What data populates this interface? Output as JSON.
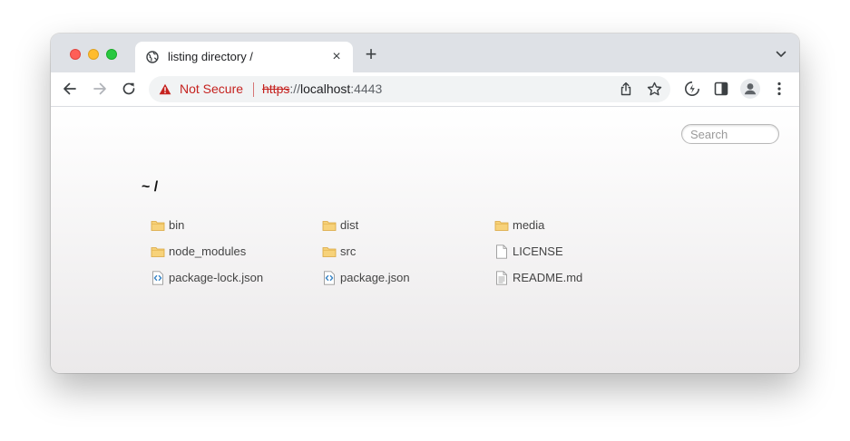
{
  "tab": {
    "title": "listing directory /",
    "close": "×",
    "new_tab": "+"
  },
  "omnibox": {
    "security": "Not Secure",
    "scheme": "https",
    "separator": "://",
    "host": "localhost",
    "port": ":4443"
  },
  "page": {
    "search_placeholder": "Search",
    "heading": "~ /",
    "files": [
      {
        "name": "bin",
        "type": "folder"
      },
      {
        "name": "dist",
        "type": "folder"
      },
      {
        "name": "media",
        "type": "folder"
      },
      {
        "name": "node_modules",
        "type": "folder"
      },
      {
        "name": "src",
        "type": "folder"
      },
      {
        "name": "LICENSE",
        "type": "file"
      },
      {
        "name": "package-lock.json",
        "type": "json"
      },
      {
        "name": "package.json",
        "type": "json"
      },
      {
        "name": "README.md",
        "type": "text"
      }
    ]
  },
  "colors": {
    "not_secure": "#c5221f",
    "folder": "#f5c35a",
    "json_icon": "#3b86c6"
  }
}
